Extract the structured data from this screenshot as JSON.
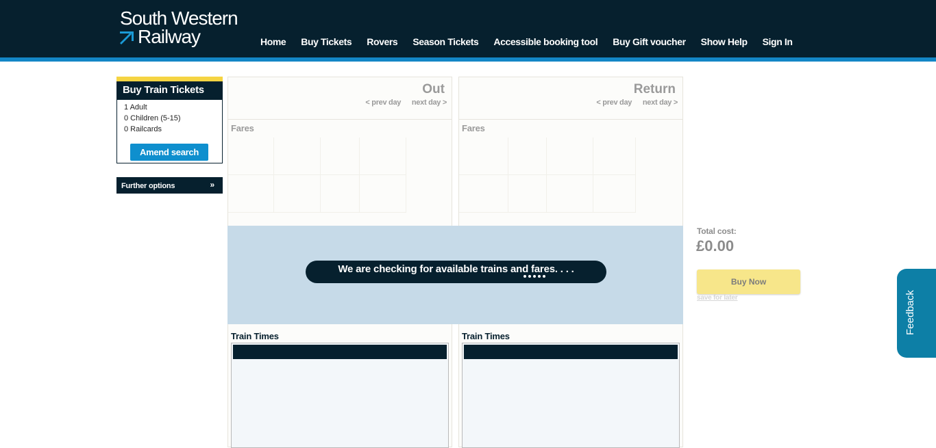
{
  "brand": {
    "line1": "South Western",
    "line2": "Railway",
    "icon": "swr-arrow-logo-icon"
  },
  "nav": {
    "items": [
      {
        "label": "Home"
      },
      {
        "label": "Buy Tickets"
      },
      {
        "label": "Rovers"
      },
      {
        "label": "Season Tickets"
      },
      {
        "label": "Accessible booking tool"
      },
      {
        "label": "Buy Gift voucher"
      },
      {
        "label": "Show Help"
      },
      {
        "label": "Sign In"
      }
    ]
  },
  "sidebar": {
    "title": "Buy Train Tickets",
    "adults": "1 Adult",
    "children": "0 Children (5-15)",
    "railcards": "0 Railcards",
    "amend_label": "Amend search",
    "further_label": "Further options",
    "further_icon": "double-chevron-down-icon"
  },
  "outbound": {
    "title": "Out",
    "prev": "< prev day",
    "next": "next day >",
    "fares_label": "Fares",
    "times_label": "Train Times"
  },
  "return": {
    "title": "Return",
    "prev": "< prev day",
    "next": "next day >",
    "fares_label": "Fares",
    "times_label": "Train Times"
  },
  "loading": {
    "message": "We are checking for available trains and fares. . . ."
  },
  "summary": {
    "total_label": "Total cost:",
    "total_value": "£0.00",
    "buy_label": "Buy Now",
    "save_label": "save for later"
  },
  "feedback": {
    "label": "Feedback"
  },
  "colors": {
    "header": "#06202e",
    "accent_stripe": "#1386c6",
    "highlight": "#f5d442",
    "button_blue": "#0f8fce",
    "buy_button": "#f7e68a",
    "overlay": "#c6dae8",
    "feedback_tab": "#0d7fa6"
  }
}
